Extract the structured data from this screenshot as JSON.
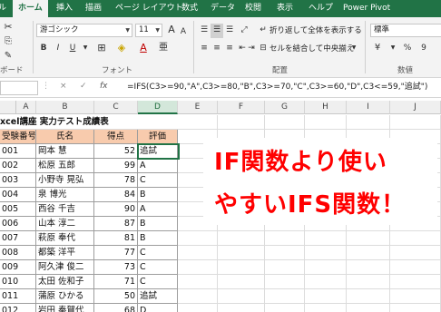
{
  "ribbon_tabs": [
    "ル",
    "ホーム",
    "挿入",
    "描画",
    "ページ レイアウト",
    "数式",
    "データ",
    "校閲",
    "表示",
    "ヘルプ",
    "Power Pivot"
  ],
  "active_tab": "ホーム",
  "ribbon": {
    "font_name": "游ゴシック",
    "font_size": "11",
    "bold": "B",
    "italic": "I",
    "underline": "U",
    "grow_font": "A",
    "shrink_font": "A",
    "wrap_text": "折り返して全体を表示する",
    "merge_center": "セルを結合して中央揃え",
    "number_format": "標準",
    "percent": "%",
    "comma": "9",
    "clipboard_label": "ボード",
    "font_label": "フォント",
    "alignment_label": "配置",
    "number_label": "数値"
  },
  "formula_bar": {
    "cancel": "×",
    "enter": "✓",
    "fx": "fx",
    "formula": "=IFS(C3>=90,\"A\",C3>=80,\"B\",C3>=70,\"C\",C3>=60,\"D\",C3<=59,\"追試\")"
  },
  "columns": [
    "A",
    "B",
    "C",
    "D",
    "E",
    "F",
    "G",
    "H",
    "I",
    "J"
  ],
  "selected_column": "D",
  "sheet": {
    "title": "xcel講座 実力テスト成績表",
    "headers": [
      "受験番号",
      "氏名",
      "得点",
      "評価"
    ],
    "rows": [
      {
        "id": "001",
        "name": "岡本 慧",
        "score": "52",
        "grade": "追試"
      },
      {
        "id": "002",
        "name": "松原 五郎",
        "score": "99",
        "grade": "A"
      },
      {
        "id": "003",
        "name": "小野寺 晃弘",
        "score": "78",
        "grade": "C"
      },
      {
        "id": "004",
        "name": "泉 博光",
        "score": "84",
        "grade": "B"
      },
      {
        "id": "005",
        "name": "西谷 千吉",
        "score": "90",
        "grade": "A"
      },
      {
        "id": "006",
        "name": "山本 淳二",
        "score": "87",
        "grade": "B"
      },
      {
        "id": "007",
        "name": "萩原 奉代",
        "score": "81",
        "grade": "B"
      },
      {
        "id": "008",
        "name": "都築 洋平",
        "score": "77",
        "grade": "C"
      },
      {
        "id": "009",
        "name": "阿久津 俊二",
        "score": "73",
        "grade": "C"
      },
      {
        "id": "010",
        "name": "太田 佐和子",
        "score": "71",
        "grade": "C"
      },
      {
        "id": "011",
        "name": "蒲原 ひかる",
        "score": "50",
        "grade": "追試"
      },
      {
        "id": "012",
        "name": "岩田 奉賀代",
        "score": "68",
        "grade": "D"
      }
    ]
  },
  "headline": {
    "line1": "IF関数より使い",
    "line2": "やすいIFS関数！"
  },
  "colors": {
    "excel_green": "#217346",
    "header_fill": "#f8cbad",
    "headline_red": "#ff0000"
  }
}
